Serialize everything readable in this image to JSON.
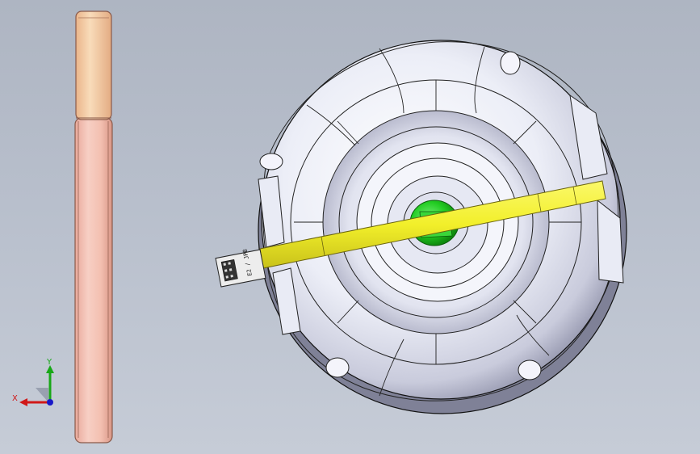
{
  "viewport": {
    "background_top": "#aeb5c2",
    "background_bottom": "#c6ccd7"
  },
  "models": {
    "rod": {
      "name": "copper-rod-part",
      "body_color": "#f3c4b6",
      "cap_color": "#f7d1a8",
      "edge_color": "#8a5a4a"
    },
    "assembly": {
      "name": "round-housing-part",
      "body_color": "#eef0f8",
      "edge_color": "#1a1a1a",
      "shaft_color": "#22cc22",
      "flex_color": "#f2ef2a",
      "connector_text": "E2 / JP8"
    }
  },
  "triad": {
    "x_label": "X",
    "y_label": "Y",
    "x_color": "#d01818",
    "y_color": "#18a818",
    "z_color": "#1818c8"
  }
}
